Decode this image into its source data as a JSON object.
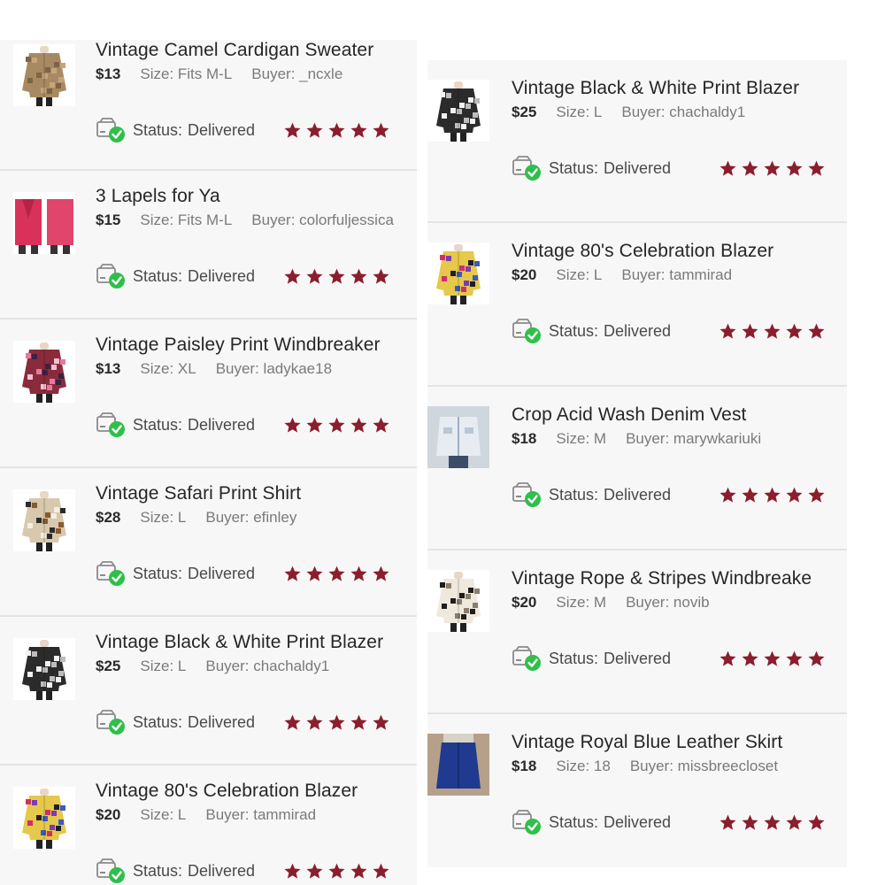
{
  "status_label": "Status:",
  "colors": {
    "star": "#8b1d2c",
    "check": "#2fbf4a",
    "row_bg": "#f7f7f7",
    "divider": "#e3e3e3"
  },
  "left_column": [
    {
      "title": "Vintage Camel Cardigan Sweater",
      "price": "$13",
      "size": "Size: Fits M-L",
      "buyer": "Buyer: _ncxle",
      "status": "Delivered",
      "rating": 5,
      "thumb": "camel-cardigan"
    },
    {
      "title": "3 Lapels for Ya",
      "price": "$15",
      "size": "Size: Fits M-L",
      "buyer": "Buyer: colorfuljessica",
      "status": "Delivered",
      "rating": 5,
      "thumb": "pink-vest"
    },
    {
      "title": "Vintage Paisley Print Windbreaker",
      "price": "$13",
      "size": "Size: XL",
      "buyer": "Buyer: ladykae18",
      "status": "Delivered",
      "rating": 5,
      "thumb": "paisley-jacket"
    },
    {
      "title": "Vintage Safari Print Shirt",
      "price": "$28",
      "size": "Size: L",
      "buyer": "Buyer: efinley",
      "status": "Delivered",
      "rating": 5,
      "thumb": "safari-shirt"
    },
    {
      "title": "Vintage Black & White Print Blazer",
      "price": "$25",
      "size": "Size: L",
      "buyer": "Buyer: chachaldy1",
      "status": "Delivered",
      "rating": 5,
      "thumb": "bw-blazer"
    },
    {
      "title": "Vintage 80's Celebration Blazer",
      "price": "$20",
      "size": "Size: L",
      "buyer": "Buyer: tammirad",
      "status": "Delivered",
      "rating": 5,
      "thumb": "celebration-blazer"
    }
  ],
  "right_column": [
    {
      "title": "Vintage Black & White Print Blazer",
      "price": "$25",
      "size": "Size: L",
      "buyer": "Buyer: chachaldy1",
      "status": "Delivered",
      "rating": 5,
      "thumb": "bw-blazer"
    },
    {
      "title": "Vintage 80's Celebration Blazer",
      "price": "$20",
      "size": "Size: L",
      "buyer": "Buyer: tammirad",
      "status": "Delivered",
      "rating": 5,
      "thumb": "celebration-blazer"
    },
    {
      "title": "Crop Acid Wash Denim Vest",
      "price": "$18",
      "size": "Size: M",
      "buyer": "Buyer: marywkariuki",
      "status": "Delivered",
      "rating": 5,
      "thumb": "denim-vest"
    },
    {
      "title": "Vintage Rope & Stripes Windbreake",
      "price": "$20",
      "size": "Size: M",
      "buyer": "Buyer: novib",
      "status": "Delivered",
      "rating": 5,
      "thumb": "rope-windbreaker"
    },
    {
      "title": "Vintage Royal Blue Leather Skirt",
      "price": "$18",
      "size": "Size: 18",
      "buyer": "Buyer: missbreecloset",
      "status": "Delivered",
      "rating": 5,
      "thumb": "blue-skirt"
    }
  ]
}
